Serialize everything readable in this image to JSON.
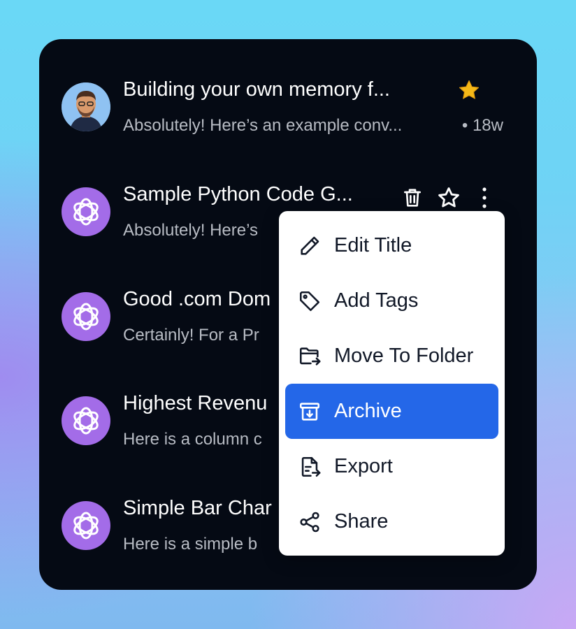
{
  "conversations": [
    {
      "title": "Building your own memory f...",
      "snippet": "Absolutely! Here’s an example conv...",
      "age": "• 18w",
      "avatar": "user-avatar",
      "starred": true
    },
    {
      "title": "Sample Python Code G...",
      "snippet": "Absolutely! Here’s",
      "avatar": "chatgpt-logo"
    },
    {
      "title": "Good .com Dom",
      "snippet": "Certainly! For a Pr",
      "avatar": "chatgpt-logo"
    },
    {
      "title": "Highest Revenu",
      "snippet": "Here is a column c",
      "avatar": "chatgpt-logo"
    },
    {
      "title": "Simple Bar Char",
      "snippet": "Here is a simple b",
      "avatar": "chatgpt-logo"
    }
  ],
  "row_actions": {
    "delete_icon": "trash-icon",
    "star_icon": "star-outline-icon",
    "more_icon": "more-vertical-icon"
  },
  "context_menu": {
    "items": [
      {
        "label": "Edit Title",
        "icon": "pencil-icon"
      },
      {
        "label": "Add Tags",
        "icon": "tag-icon"
      },
      {
        "label": "Move To Folder",
        "icon": "folder-move-icon"
      },
      {
        "label": "Archive",
        "icon": "archive-icon",
        "active": true
      },
      {
        "label": "Export",
        "icon": "file-export-icon"
      },
      {
        "label": "Share",
        "icon": "share-icon"
      }
    ]
  },
  "colors": {
    "panel": "#050a14",
    "accent": "#2467e8",
    "gpt_avatar": "#a36ce8",
    "star": "#f5b918"
  }
}
